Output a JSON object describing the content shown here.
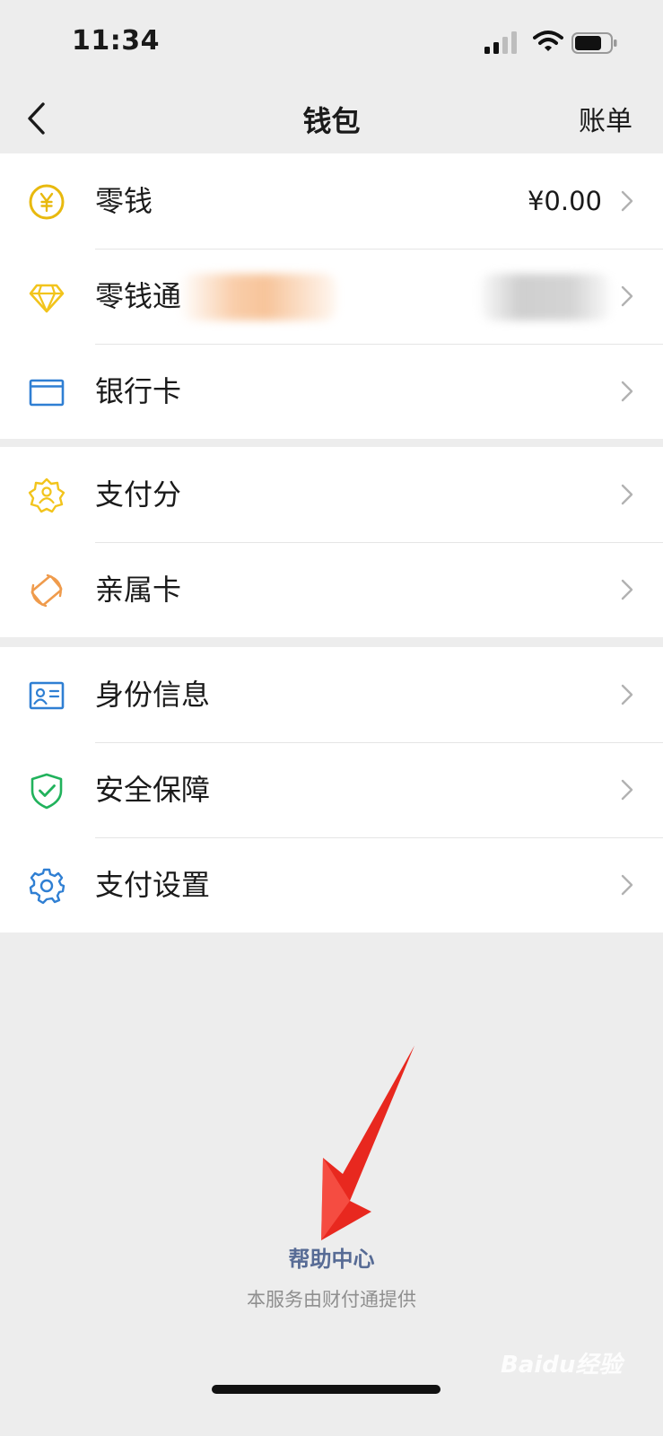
{
  "status_bar": {
    "time": "11:34"
  },
  "nav": {
    "title": "钱包",
    "right": "账单"
  },
  "groups": [
    {
      "items": [
        {
          "label": "零钱",
          "icon": "yen-coin-icon",
          "value": "¥0.00",
          "color": "#e8b90e"
        },
        {
          "label": "零钱通",
          "icon": "diamond-icon",
          "value": "",
          "color": "#f2c41c"
        },
        {
          "label": "银行卡",
          "icon": "bank-card-icon",
          "value": "",
          "color": "#2f7fd3"
        }
      ]
    },
    {
      "items": [
        {
          "label": "支付分",
          "icon": "pay-score-badge-icon",
          "color": "#f2c41c"
        },
        {
          "label": "亲属卡",
          "icon": "family-card-icon",
          "color": "#ef9b4c"
        }
      ]
    },
    {
      "items": [
        {
          "label": "身份信息",
          "icon": "id-card-icon",
          "color": "#2f7fd3"
        },
        {
          "label": "安全保障",
          "icon": "shield-check-icon",
          "color": "#21b25c"
        },
        {
          "label": "支付设置",
          "icon": "gear-icon",
          "color": "#2f7fd3"
        }
      ]
    }
  ],
  "footer": {
    "help": "帮助中心",
    "provider": "本服务由财付通提供",
    "watermark": "Baidu经验"
  },
  "colors": {
    "link": "#576b95",
    "annotation_arrow": "#e8281f",
    "background": "#ededed"
  }
}
